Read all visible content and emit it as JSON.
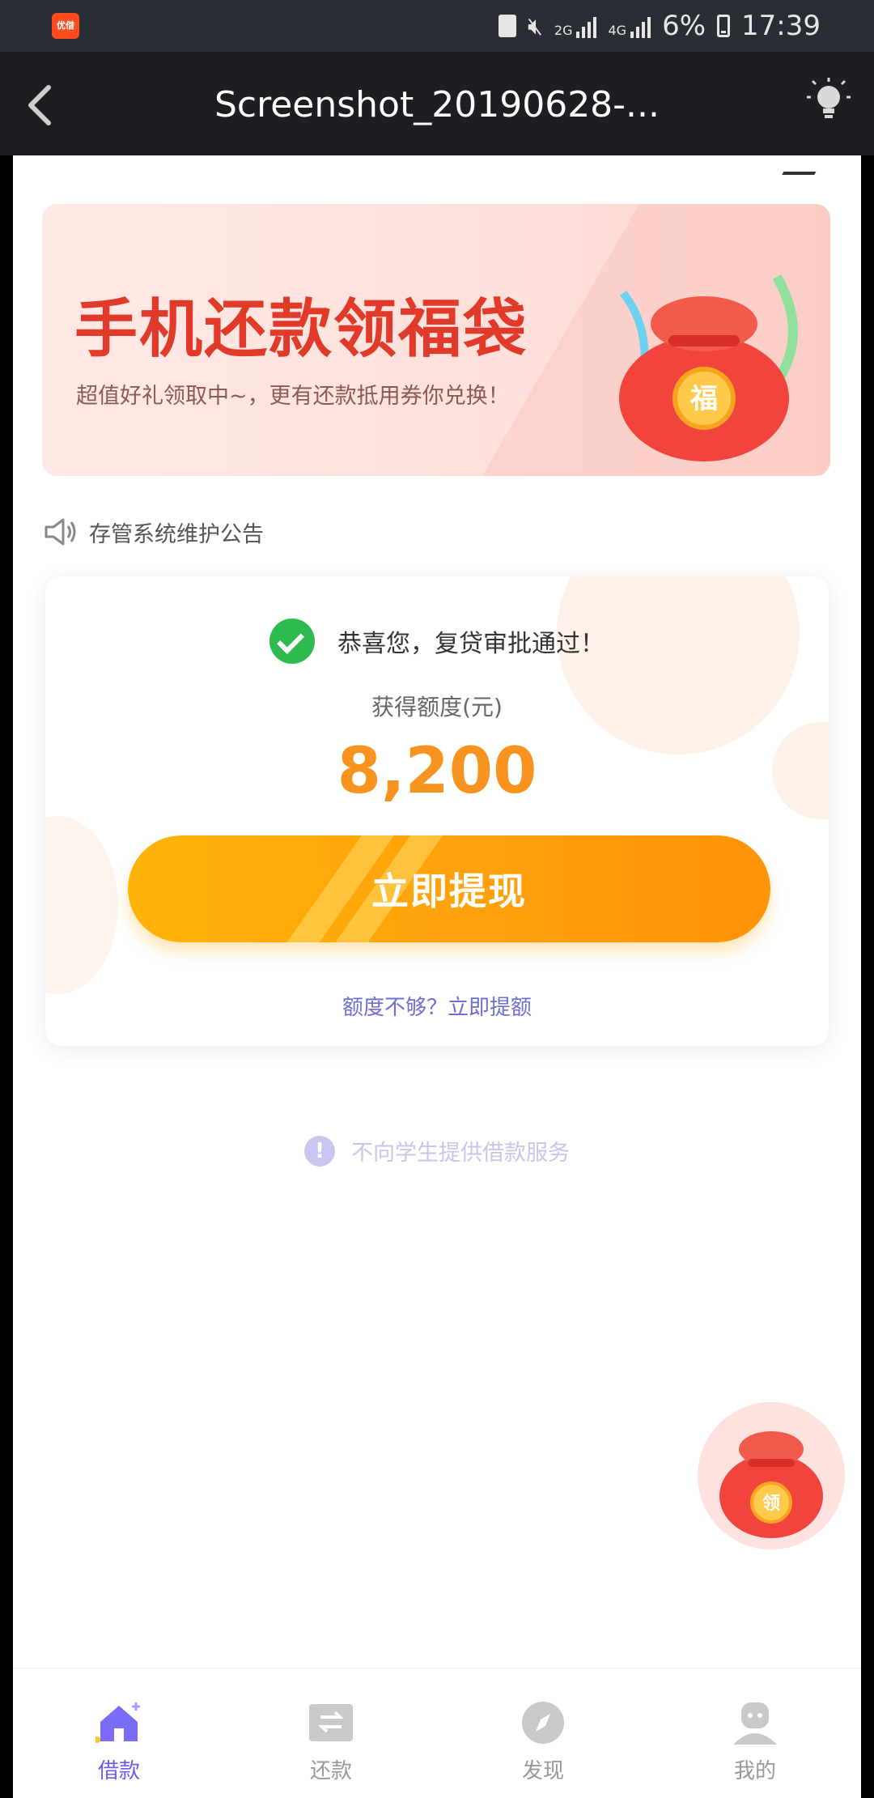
{
  "status_bar": {
    "app_badge": "优借",
    "network_2g": "2G",
    "network_4g": "4G",
    "battery": "6%",
    "time": "17:39"
  },
  "top_bar": {
    "title": "Screenshot_20190628-..."
  },
  "banner": {
    "title": "手机还款领福袋",
    "subtitle": "超值好礼领取中~，更有还款抵用券你兑换！",
    "bag_char": "福"
  },
  "notice": {
    "text": "存管系统维护公告"
  },
  "card": {
    "approval_text": "恭喜您，复贷审批通过！",
    "limit_label": "获得额度(元)",
    "amount": "8,200",
    "withdraw_button": "立即提现",
    "increase_link": "额度不够？立即提额"
  },
  "disclaimer": {
    "text": "不向学生提供借款服务"
  },
  "float_button": {
    "char": "领"
  },
  "tabs": [
    {
      "label": "借款",
      "icon": "home-icon",
      "active": true
    },
    {
      "label": "还款",
      "icon": "repay-icon",
      "active": false
    },
    {
      "label": "发现",
      "icon": "compass-icon",
      "active": false
    },
    {
      "label": "我的",
      "icon": "profile-icon",
      "active": false
    }
  ],
  "colors": {
    "accent_orange": "#f7931e",
    "active_tab": "#6b5cf0",
    "banner_red": "#e03b2a"
  }
}
